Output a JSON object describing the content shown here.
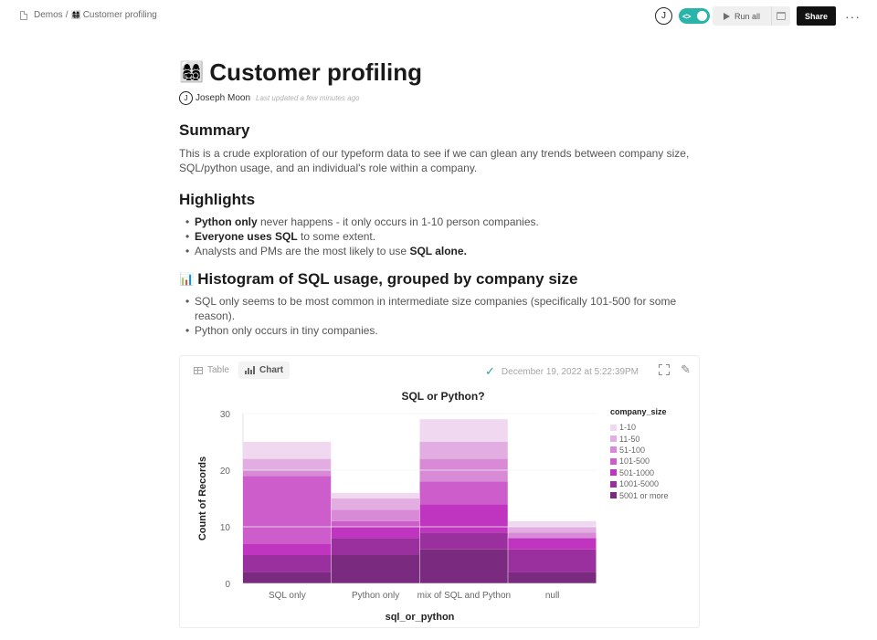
{
  "breadcrumb": {
    "parent": "Demos",
    "separator": "/",
    "emoji": "👩‍👩‍👧‍👦",
    "current": "Customer profiling"
  },
  "toolbar": {
    "avatar_initial": "J",
    "toggle_label": "<>",
    "run_all_label": "Run all",
    "share_label": "Share",
    "more_label": "···"
  },
  "doc": {
    "title_emoji": "👩‍👩‍👧‍👦",
    "title": "Customer profiling",
    "author_initial": "J",
    "author": "Joseph Moon",
    "updated": "Last updated a few minutes ago",
    "summary_heading": "Summary",
    "summary_text": "This is a crude exploration of our typeform data to see if we can glean any trends between company size, SQL/python usage, and an individual's role within a company.",
    "highlights_heading": "Highlights",
    "highlights": [
      {
        "bold": "Python only",
        "rest": " never happens - it only occurs in 1-10 person companies."
      },
      {
        "bold": "Everyone uses SQL",
        "rest": " to some extent."
      },
      {
        "pre": "Analysts and PMs are the most likely to use ",
        "bold": "SQL alone."
      }
    ],
    "histogram_emoji": "📊",
    "histogram_heading": "Histogram of SQL usage, grouped by company size",
    "histogram_points": [
      "SQL only seems to be most common in intermediate size companies (specifically 101-500 for some reason).",
      "Python only occurs in tiny companies."
    ]
  },
  "chart_card": {
    "tab_table": "Table",
    "tab_chart": "Chart",
    "active_tab": "Chart",
    "status_time": "December 19, 2022 at 5:22:39PM"
  },
  "chart_data": {
    "type": "bar",
    "stacked": true,
    "title": "SQL or Python?",
    "xlabel": "sql_or_python",
    "ylabel": "Count of Records",
    "ylim": [
      0,
      30
    ],
    "yticks": [
      0,
      10,
      20,
      30
    ],
    "grid": true,
    "categories": [
      "SQL only",
      "Python only",
      "mix of SQL and Python",
      "null"
    ],
    "legend_title": "company_size",
    "legend_position": "right",
    "series": [
      {
        "name": "5001 or more",
        "color": "#7a2a7f",
        "values": [
          2,
          5,
          6,
          2
        ]
      },
      {
        "name": "1001-5000",
        "color": "#9a2f9e",
        "values": [
          3,
          3,
          3,
          4
        ]
      },
      {
        "name": "501-1000",
        "color": "#c035bf",
        "values": [
          2,
          2,
          5,
          2
        ]
      },
      {
        "name": "101-500",
        "color": "#cc5dcb",
        "values": [
          12,
          1,
          4,
          0
        ]
      },
      {
        "name": "51-100",
        "color": "#d88ad6",
        "values": [
          1,
          2,
          4,
          1
        ]
      },
      {
        "name": "11-50",
        "color": "#e2aee1",
        "values": [
          2,
          2,
          3,
          1
        ]
      },
      {
        "name": "1-10",
        "color": "#f1d8f1",
        "values": [
          3,
          1,
          4,
          1
        ]
      }
    ]
  }
}
